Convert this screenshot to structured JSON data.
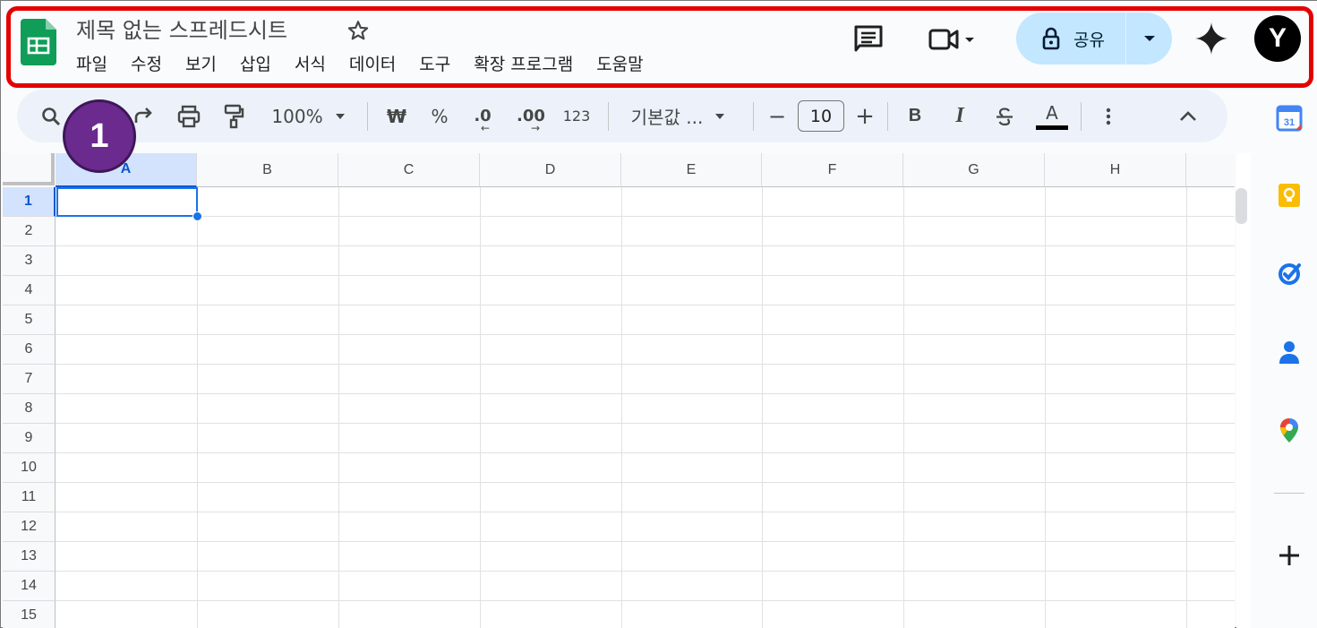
{
  "app": {
    "title": "제목 없는 스프레드시트",
    "brand_color": "#0f9d58",
    "menus": [
      "파일",
      "수정",
      "보기",
      "삽입",
      "서식",
      "데이터",
      "도구",
      "확장 프로그램",
      "도움말"
    ],
    "share_label": "공유",
    "avatar_initial": "Y"
  },
  "toolbar": {
    "zoom": "100%",
    "currency_label": "₩",
    "percent_label": "%",
    "dec_decrease_label": ".0",
    "dec_increase_label": ".00",
    "number_format_label": "123",
    "font_label": "기본값 ...",
    "font_size": "10",
    "bold_label": "B",
    "italic_label": "I",
    "text_color_label": "A",
    "minus_label": "−",
    "plus_label": "+"
  },
  "annotation": {
    "step_number": "1",
    "highlight_color": "#e40000",
    "badge_color": "#6b2a8e"
  },
  "grid": {
    "columns": [
      "A",
      "B",
      "C",
      "D",
      "E",
      "F",
      "G",
      "H"
    ],
    "rows": [
      "1",
      "2",
      "3",
      "4",
      "5",
      "6",
      "7",
      "8",
      "9",
      "10",
      "11",
      "12",
      "13",
      "14",
      "15"
    ],
    "selected_cell": "A1",
    "selection_color": "#1a73e8"
  },
  "side_panel": {
    "calendar_day": "31",
    "icons": [
      "calendar-icon",
      "keep-icon",
      "tasks-icon",
      "contacts-icon",
      "maps-icon",
      "add-icon"
    ]
  }
}
